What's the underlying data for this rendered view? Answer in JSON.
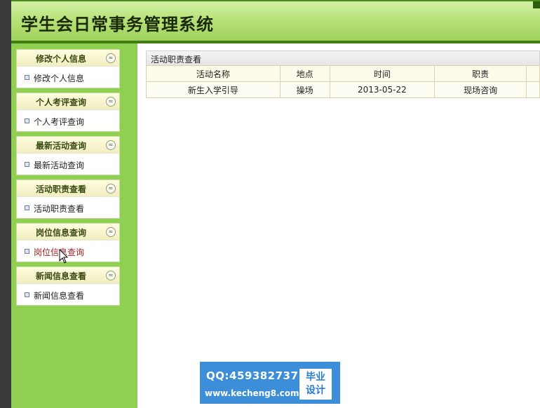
{
  "header": {
    "title": "学生会日常事务管理系统"
  },
  "sidebar": {
    "groups": [
      {
        "title": "修改个人信息",
        "item": "修改个人信息"
      },
      {
        "title": "个人考评查询",
        "item": "个人考评查询"
      },
      {
        "title": "最新活动查询",
        "item": "最新活动查询"
      },
      {
        "title": "活动职责查看",
        "item": "活动职责查看"
      },
      {
        "title": "岗位信息查询",
        "item": "岗位信息查询"
      },
      {
        "title": "新闻信息查看",
        "item": "新闻信息查看"
      }
    ],
    "active_index": 4,
    "collapse_glyph": "≈"
  },
  "main": {
    "panel_title": "活动职责查看",
    "columns": [
      "活动名称",
      "地点",
      "时间",
      "职责"
    ],
    "rows": [
      [
        "新生入学引导",
        "操场",
        "2013-05-22",
        "现场咨询"
      ]
    ]
  },
  "watermark": {
    "qq": "QQ:459382737",
    "url": "www.kecheng8.com",
    "badge_line1": "毕业",
    "badge_line2": "设计"
  },
  "colors": {
    "header_green": "#9fd15b",
    "sidebar_green": "#8fcf52",
    "active_link": "#9b1c1c",
    "watermark_blue": "#3d8ed8"
  }
}
